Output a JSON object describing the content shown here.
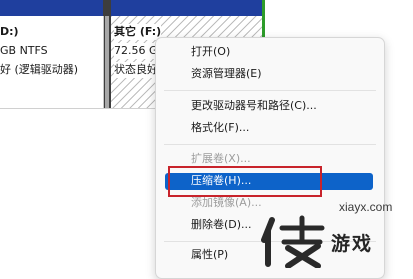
{
  "disk_left": {
    "label": "D:)",
    "size": "GB NTFS",
    "status": "好 (逻辑驱动器)"
  },
  "disk_right": {
    "label": "其它 (F:)",
    "size": "72.56 G",
    "status": "状态良好"
  },
  "context_menu": {
    "items": [
      {
        "label": "打开(O)",
        "enabled": true
      },
      {
        "label": "资源管理器(E)",
        "enabled": true
      },
      {
        "label": "更改驱动器号和路径(C)...",
        "enabled": true
      },
      {
        "label": "格式化(F)...",
        "enabled": true
      },
      {
        "label": "扩展卷(X)...",
        "enabled": false
      },
      {
        "label": "压缩卷(H)...",
        "enabled": true,
        "selected": true
      },
      {
        "label": "添加镜像(A)...",
        "enabled": false
      },
      {
        "label": "删除卷(D)...",
        "enabled": true
      },
      {
        "label": "属性(P)",
        "enabled": true
      }
    ]
  },
  "watermark": {
    "url": "xiayx.com",
    "logo_text": "游戏",
    "logo_icon": "xia-character-logo"
  },
  "colors": {
    "highlight": "#0d63c9",
    "annotation_box": "#c8232b",
    "disk_header": "#1f3f9e"
  }
}
